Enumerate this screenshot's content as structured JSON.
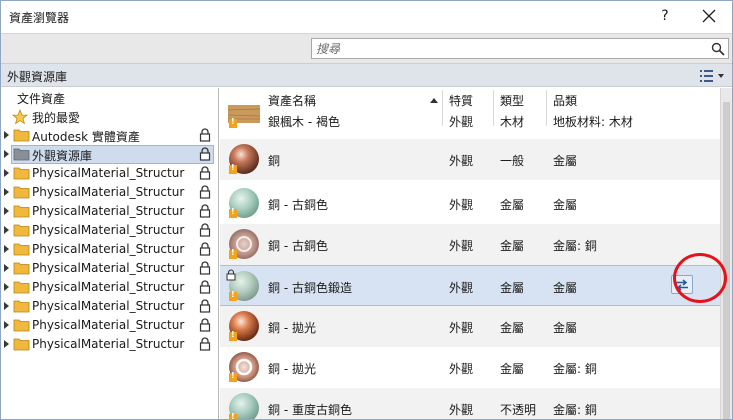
{
  "window": {
    "title": "資產瀏覽器",
    "help_label": "?"
  },
  "search": {
    "placeholder": "搜尋"
  },
  "library": {
    "title": "外觀資源庫"
  },
  "tree": {
    "section_label": "文件資產",
    "favorites_label": "我的最愛",
    "items": [
      {
        "label": "Autodesk 實體資產",
        "selected": false
      },
      {
        "label": "外觀資源庫",
        "selected": true
      },
      {
        "label": "PhysicalMaterial_Structur",
        "selected": false
      },
      {
        "label": "PhysicalMaterial_Structur",
        "selected": false
      },
      {
        "label": "PhysicalMaterial_Structur",
        "selected": false
      },
      {
        "label": "PhysicalMaterial_Structur",
        "selected": false
      },
      {
        "label": "PhysicalMaterial_Structur",
        "selected": false
      },
      {
        "label": "PhysicalMaterial_Structur",
        "selected": false
      },
      {
        "label": "PhysicalMaterial_Structur",
        "selected": false
      },
      {
        "label": "PhysicalMaterial_Structur",
        "selected": false
      },
      {
        "label": "PhysicalMaterial_Structur",
        "selected": false
      },
      {
        "label": "PhysicalMaterial_Structur",
        "selected": false
      }
    ]
  },
  "table": {
    "headers": {
      "name": "資產名稱",
      "trait": "特質",
      "type": "類型",
      "category": "品類"
    },
    "rows": [
      {
        "name": "銀楓木 - 褐色",
        "trait": "外觀",
        "type": "木材",
        "category": "地板材料: 木材"
      },
      {
        "name": "銅",
        "trait": "外觀",
        "type": "一般",
        "category": "金屬"
      },
      {
        "name": "銅 - 古銅色",
        "trait": "外觀",
        "type": "金屬",
        "category": "金屬"
      },
      {
        "name": "銅 - 古銅色",
        "trait": "外觀",
        "type": "金屬",
        "category": "金屬: 銅"
      },
      {
        "name": "銅 - 古銅色鍛造",
        "trait": "外觀",
        "type": "金屬",
        "category": "金屬"
      },
      {
        "name": "銅 - 拋光",
        "trait": "外觀",
        "type": "金屬",
        "category": "金屬"
      },
      {
        "name": "銅 - 拋光",
        "trait": "外觀",
        "type": "金屬",
        "category": "金屬: 銅"
      },
      {
        "name": "銅 - 重度古銅色",
        "trait": "外觀",
        "type": "不透明",
        "category": "金屬: 銅"
      }
    ]
  },
  "colors": {
    "selection": "#d7e3f2",
    "highlight_ring": "#e3131b",
    "folder": "#f0b93e"
  }
}
